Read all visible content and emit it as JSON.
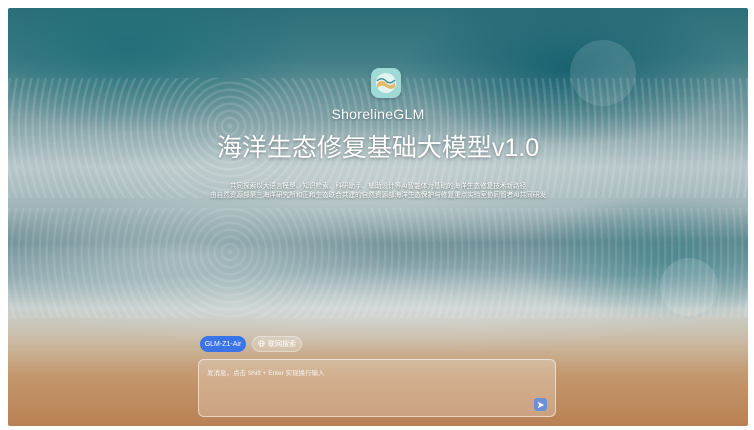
{
  "brand": {
    "name": "ShorelineGLM"
  },
  "hero": {
    "title": "海洋生态修复基础大模型v1.0",
    "subtitle_line1": "共同探索以大语言模型、知识检索、科研助手、辅助设计等AI智能体为基础的海洋生态修复技术新路径",
    "subtitle_line2": "由自然资源部第三海洋研究所和正和生态联合共建的自然资源部海洋生态保护与修复重点实验室协同智者AI共同研发"
  },
  "controls": {
    "model_chip": "GLM-Z1-Air",
    "web_search_chip": "联网搜索"
  },
  "input": {
    "placeholder": "发消息，点击 Shift + Enter 实现换行输入",
    "value": ""
  },
  "colors": {
    "accent": "#3b73e8",
    "send_button": "#6e8fd4",
    "logo_bg": "#9fdad6"
  },
  "icons": {
    "logo": "shoreline-logo-icon",
    "web_search": "globe-icon",
    "send": "send-icon"
  }
}
